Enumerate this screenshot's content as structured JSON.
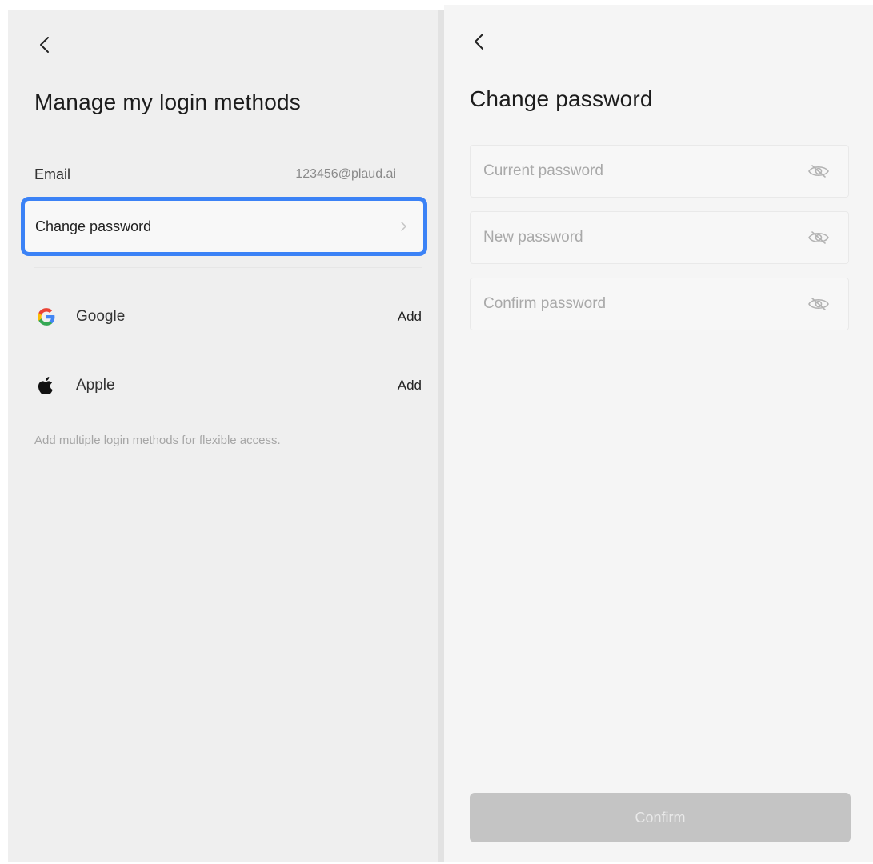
{
  "left_screen": {
    "title": "Manage my login methods",
    "email": {
      "label": "Email",
      "value": "123456@plaud.ai"
    },
    "change_password": {
      "label": "Change password"
    },
    "providers": [
      {
        "name": "Google",
        "action": "Add",
        "icon": "google-icon"
      },
      {
        "name": "Apple",
        "action": "Add",
        "icon": "apple-icon"
      }
    ],
    "hint": "Add multiple login methods for flexible access.",
    "highlight_color": "#3b82f6"
  },
  "right_screen": {
    "title": "Change password",
    "fields": [
      {
        "placeholder": "Current password",
        "icon": "eye-hidden-icon"
      },
      {
        "placeholder": "New password",
        "icon": "eye-hidden-icon"
      },
      {
        "placeholder": "Confirm password",
        "icon": "eye-hidden-icon"
      }
    ],
    "confirm_label": "Confirm"
  }
}
